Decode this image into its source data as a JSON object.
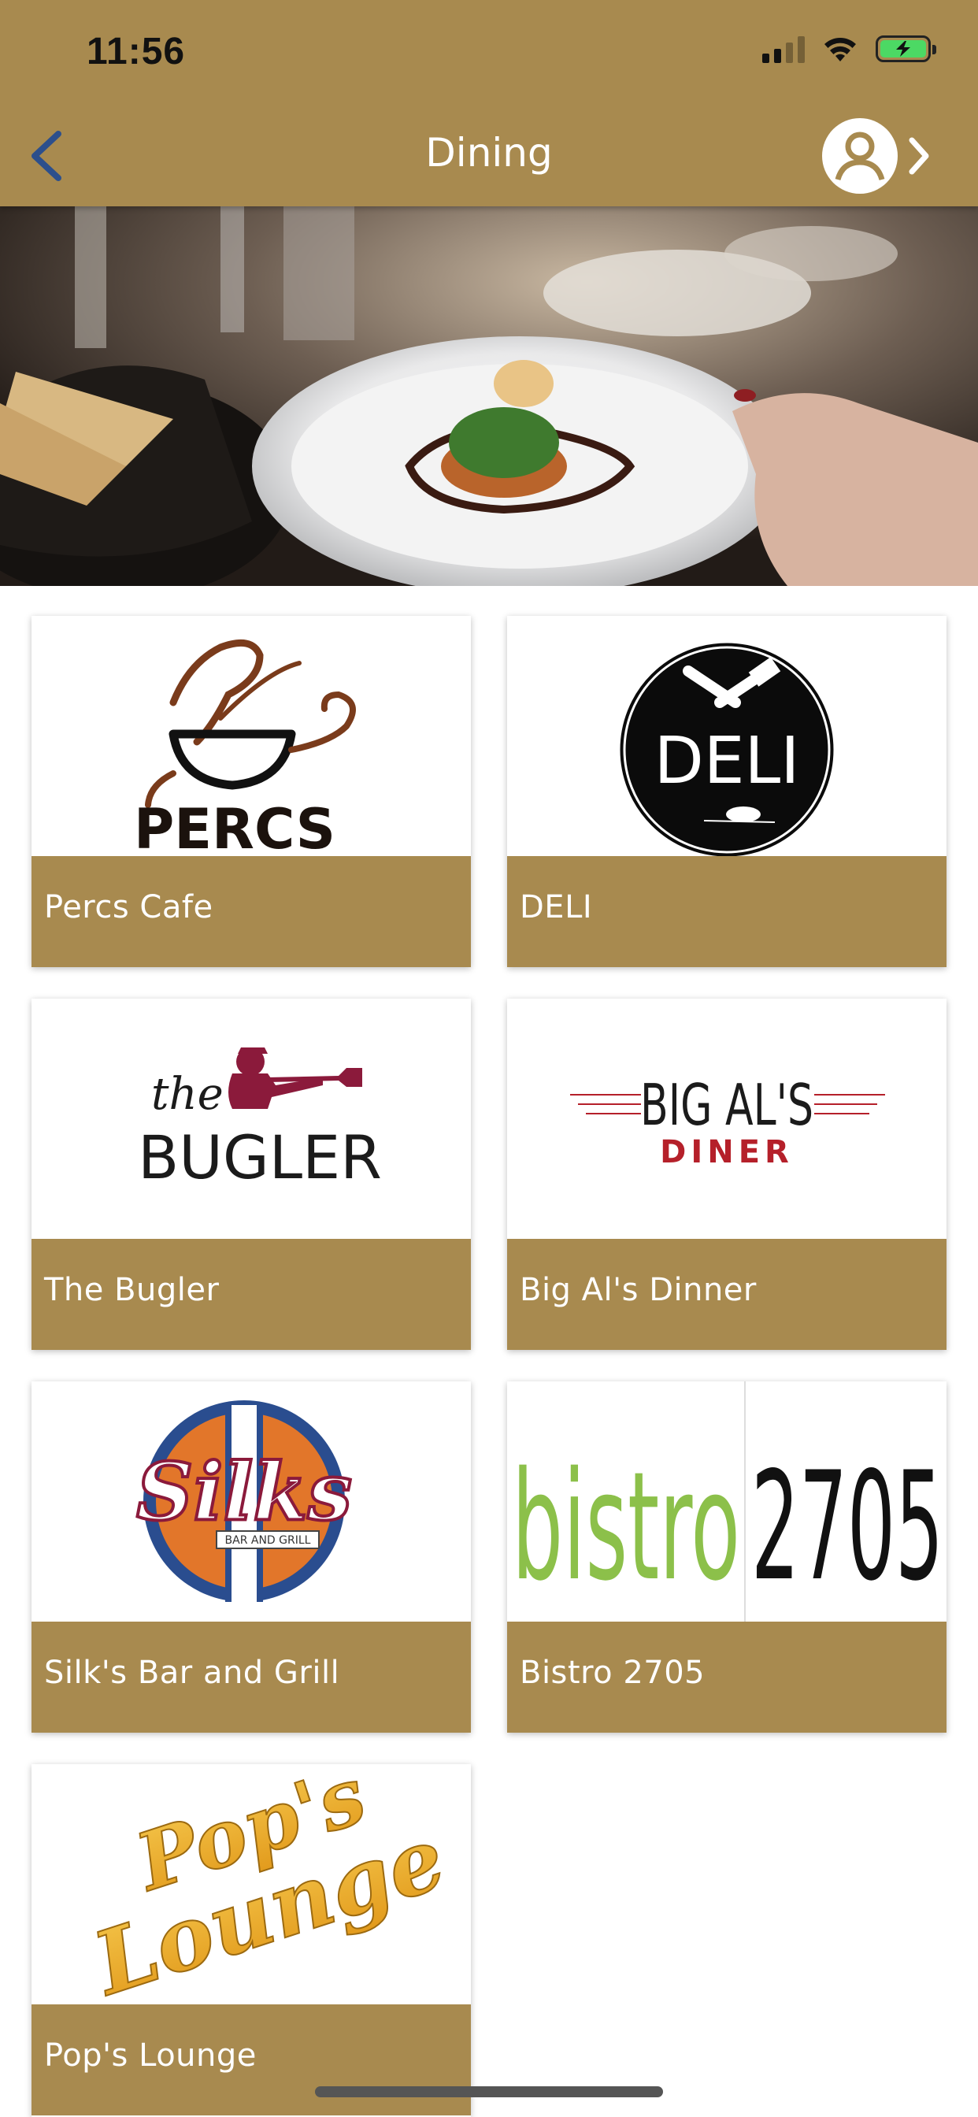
{
  "status_bar": {
    "time": "11:56",
    "icons": [
      "cellular-signal-icon",
      "wifi-icon",
      "battery-charging-icon"
    ]
  },
  "header": {
    "title": "Dining",
    "back_icon": "chevron-left-icon",
    "profile_icon": "user-circle-icon",
    "profile_chevron_icon": "chevron-right-icon"
  },
  "colors": {
    "brand_gold": "#A88A4F",
    "nav_blue": "#2C4F8C",
    "white": "#FFFFFF"
  },
  "hero": {
    "image": "restaurant-plate-photo"
  },
  "restaurants": [
    {
      "label": "Percs Cafe",
      "logo_text": "PERCS"
    },
    {
      "label": "DELI",
      "logo_text": "DELI"
    },
    {
      "label": "The Bugler",
      "logo_text": [
        "the",
        "BUGLER"
      ]
    },
    {
      "label": "Big Al's Dinner",
      "logo_text": [
        "BIG AL'S",
        "DINER"
      ]
    },
    {
      "label": "Silk's Bar and Grill",
      "logo_text": [
        "Silks",
        "BAR AND GRILL"
      ]
    },
    {
      "label": "Bistro 2705",
      "logo_text": [
        "bistro",
        "2705"
      ]
    },
    {
      "label": "Pop's Lounge",
      "logo_text": [
        "Pop's",
        "Lounge"
      ]
    }
  ]
}
